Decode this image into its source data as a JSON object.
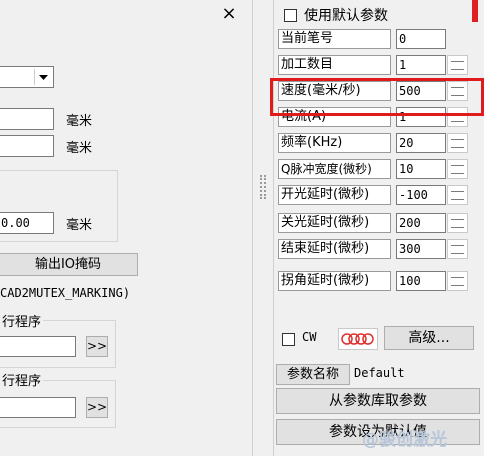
{
  "left_panel": {
    "close_glyph": "×",
    "unit_mm": "毫米",
    "value_field": "0.00",
    "output_button": "输出IO掩码",
    "mutex_text": "CAD2MUTEX_MARKING)",
    "group1_label": "行程序",
    "group2_label": "行程序",
    "browse_label": ">>"
  },
  "right_panel": {
    "use_default_label": "使用默认参数",
    "params": [
      {
        "label": "当前笔号",
        "value": "0"
      },
      {
        "label": "加工数目",
        "value": "1"
      },
      {
        "label": "速度(毫米/秒)",
        "value": "500"
      },
      {
        "label": "电流(A)",
        "value": "1"
      },
      {
        "label": "频率(KHz)",
        "value": "20"
      },
      {
        "label": "Q脉冲宽度(微秒)",
        "value": "10"
      },
      {
        "label": "开光延时(微秒)",
        "value": "-100"
      },
      {
        "label": "关光延时(微秒)",
        "value": "200"
      },
      {
        "label": "结束延时(微秒)",
        "value": "300"
      },
      {
        "label": "拐角延时(微秒)",
        "value": "100"
      }
    ],
    "cw_label": "CW",
    "advanced_button": "高级...",
    "param_name_label": "参数名称",
    "param_name_value": "Default",
    "from_library_button": "从参数库取参数",
    "set_default_button": "参数设为默认值"
  },
  "watermark": "@骏创激光",
  "colors": {
    "highlight": "#e01b1b",
    "wave_icon": "#e03030"
  }
}
